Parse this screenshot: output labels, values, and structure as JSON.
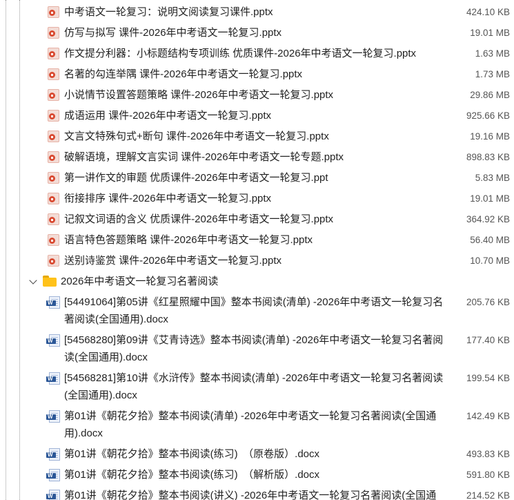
{
  "ppt_files": [
    {
      "name": "中考语文一轮复习：说明文阅读复习课件.pptx",
      "size": "424.10 KB"
    },
    {
      "name": "仿写与拟写 课件-2026年中考语文一轮复习.pptx",
      "size": "19.01 MB"
    },
    {
      "name": "作文提分利器：小标题结构专项训练 优质课件-2026年中考语文一轮复习.pptx",
      "size": "1.63 MB"
    },
    {
      "name": "名著的勾连举隅 课件-2026年中考语文一轮复习.pptx",
      "size": "1.73 MB"
    },
    {
      "name": "小说情节设置答题策略 课件-2026年中考语文一轮复习.pptx",
      "size": "29.86 MB"
    },
    {
      "name": "成语运用 课件-2026年中考语文一轮复习.pptx",
      "size": "925.66 KB"
    },
    {
      "name": "文言文特殊句式+断句 课件-2026年中考语文一轮复习.pptx",
      "size": "19.16 MB"
    },
    {
      "name": "破解语境，理解文言实词 课件-2026年中考语文一轮专题.pptx",
      "size": "898.83 KB"
    },
    {
      "name": "第一讲作文的审题 优质课件-2026年中考语文一轮复习.ppt",
      "size": "5.83 MB"
    },
    {
      "name": "衔接排序 课件-2026年中考语文一轮复习.pptx",
      "size": "19.01 MB"
    },
    {
      "name": "记叙文词语的含义 优质课件-2026年中考语文一轮复习.pptx",
      "size": "364.92 KB"
    },
    {
      "name": "语言特色答题策略 课件-2026年中考语文一轮复习.pptx",
      "size": "56.40 MB"
    },
    {
      "name": "送别诗鉴赏 课件-2026年中考语文一轮复习.pptx",
      "size": "10.70 MB"
    }
  ],
  "folder": {
    "name": "2026年中考语文一轮复习名著阅读"
  },
  "doc_files": [
    {
      "line1": "[54491064]第05讲《红星照耀中国》整本书阅读(清单) -2026年中考语文一轮复习名",
      "line2": "著阅读(全国通用).docx",
      "size": "205.76 KB"
    },
    {
      "line1": "[54568280]第09讲《艾青诗选》整本书阅读(清单) -2026年中考语文一轮复习名著阅",
      "line2": "读(全国通用).docx",
      "size": "177.40 KB"
    },
    {
      "line1": "[54568281]第10讲《水浒传》整本书阅读(清单) -2026年中考语文一轮复习名著阅读",
      "line2": "(全国通用).docx",
      "size": "199.54 KB"
    },
    {
      "line1": "第01讲《朝花夕拾》整本书阅读(清单) -2026年中考语文一轮复习名著阅读(全国通",
      "line2": "用).docx",
      "size": "142.49 KB"
    },
    {
      "line1": "第01讲《朝花夕拾》整本书阅读(练习)　（原卷版）.docx",
      "line2": "",
      "size": "493.83 KB"
    },
    {
      "line1": "第01讲《朝花夕拾》整本书阅读(练习)　（解析版）.docx",
      "line2": "",
      "size": "591.80 KB"
    },
    {
      "line1": "第01讲《朝花夕拾》整本书阅读(讲义) -2026年中考语文一轮复习名著阅读(全国通",
      "line2": "",
      "size": "214.52 KB"
    }
  ]
}
